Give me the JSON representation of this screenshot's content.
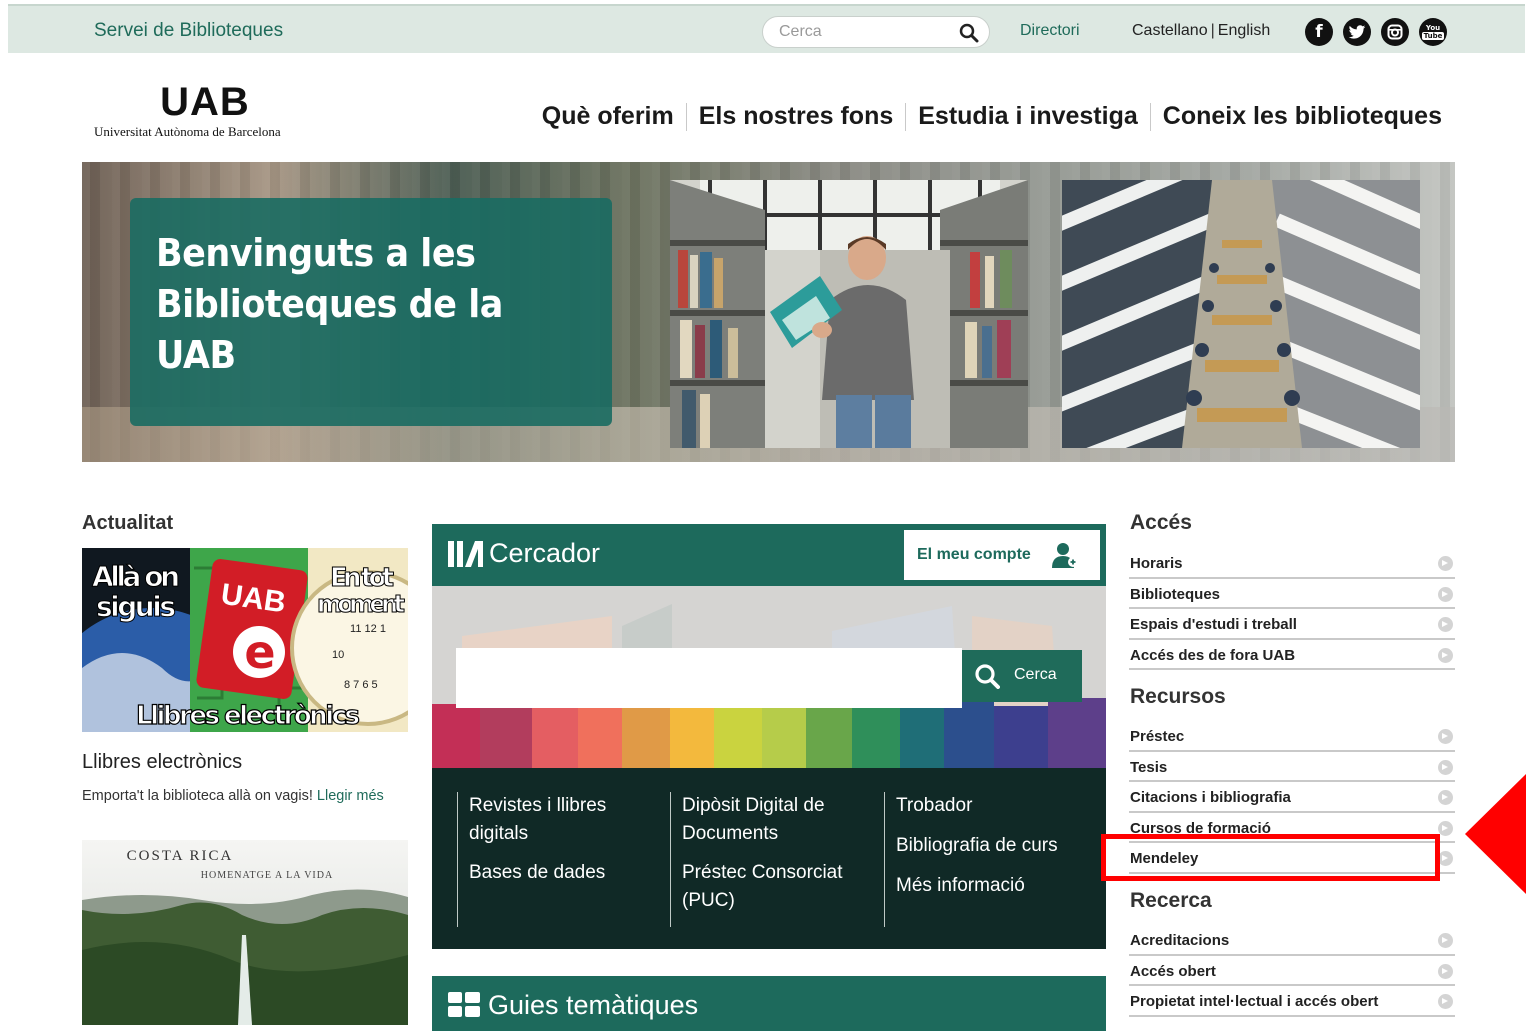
{
  "topbar": {
    "site_name": "Servei de Biblioteques",
    "search_placeholder": "Cerca",
    "directory": "Directori",
    "lang_es": "Castellano",
    "lang_sep": "|",
    "lang_en": "English",
    "social": {
      "facebook": "f",
      "youtube_top": "You",
      "youtube_bottom": "Tube"
    }
  },
  "logo": {
    "mark": "UAB",
    "university": "Universitat Autònoma de Barcelona"
  },
  "nav": [
    {
      "label": "Què oferim"
    },
    {
      "label": "Els nostres fons"
    },
    {
      "label": "Estudia i investiga"
    },
    {
      "label": "Coneix les biblioteques"
    }
  ],
  "hero": {
    "line1": "Benvinguts a les",
    "line2": "Biblioteques de la UAB"
  },
  "news": {
    "section": "Actualitat",
    "image_texts": {
      "left_top": "Allà on",
      "left_bottom": "siguis",
      "center": "UAB",
      "center_letter": "e",
      "right_top": "En tot",
      "right_bottom": "moment",
      "banner": "Llibres electrònics"
    },
    "title": "Llibres electrònics",
    "text": "Emporta't la biblioteca allà on vagis!",
    "more": "Llegir més",
    "second": {
      "line1": "COSTA RICA",
      "line2": "HOMENATGE A LA VIDA"
    }
  },
  "cercador": {
    "title": "Cercador",
    "account": "El meu compte",
    "search_button": "Cerca",
    "columns": [
      [
        "Revistes i llibres digitals",
        "Bases de dades"
      ],
      [
        "Dipòsit Digital de Documents",
        "Préstec Consorciat (PUC)"
      ],
      [
        "Trobador",
        "Bibliografia de curs",
        "Més informació"
      ]
    ]
  },
  "guies": {
    "title": "Guies temàtiques"
  },
  "sidebar": {
    "acces": {
      "title": "Accés",
      "items": [
        "Horaris",
        "Biblioteques",
        "Espais d'estudi i treball",
        "Accés des de fora UAB"
      ]
    },
    "recursos": {
      "title": "Recursos",
      "items": [
        "Préstec",
        "Tesis",
        "Citacions i bibliografia",
        "Cursos de formació",
        "Mendeley"
      ]
    },
    "recerca": {
      "title": "Recerca",
      "items": [
        "Acreditacions",
        "Accés obert",
        "Propietat intel·lectual i accés obert"
      ]
    }
  },
  "colors": {
    "brand_green": "#1d6a5c",
    "topbar_bg": "#dde8e2",
    "highlight_red": "#ff0000"
  }
}
